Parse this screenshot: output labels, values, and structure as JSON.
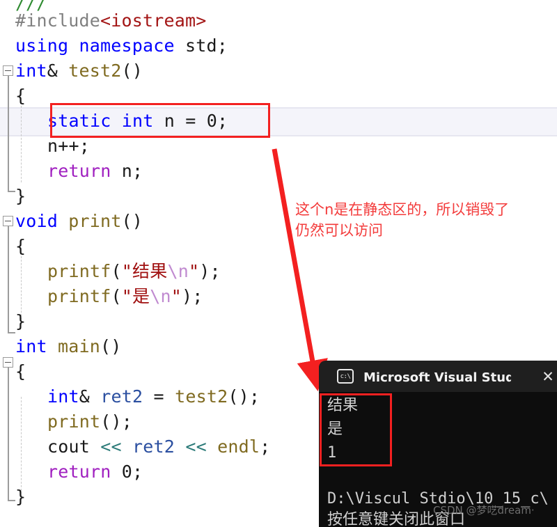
{
  "editor": {
    "top_cut_comment": "///",
    "lines": [
      {
        "indent": 0,
        "segments": [
          {
            "t": "#include",
            "c": "k-gray"
          },
          {
            "t": "<iostream>",
            "c": "k-darkred"
          }
        ]
      },
      {
        "indent": 0,
        "segments": [
          {
            "t": "using namespace ",
            "c": "k-blue"
          },
          {
            "t": "std;",
            "c": "k-black"
          }
        ]
      },
      {
        "indent": 0,
        "segments": [
          {
            "t": "int",
            "c": "k-blue"
          },
          {
            "t": "& ",
            "c": "k-black"
          },
          {
            "t": "test2",
            "c": "k-olive"
          },
          {
            "t": "()",
            "c": "k-black"
          }
        ]
      },
      {
        "indent": 0,
        "segments": [
          {
            "t": "{",
            "c": "k-black"
          }
        ]
      },
      {
        "indent": 1,
        "segments": [
          {
            "t": "static int",
            "c": "k-blue"
          },
          {
            "t": " n = ",
            "c": "k-black"
          },
          {
            "t": "0",
            "c": "k-black"
          },
          {
            "t": ";",
            "c": "k-black"
          }
        ]
      },
      {
        "indent": 1,
        "segments": [
          {
            "t": "n++;",
            "c": "k-black"
          }
        ]
      },
      {
        "indent": 1,
        "segments": [
          {
            "t": "return",
            "c": "k-purple"
          },
          {
            "t": " n;",
            "c": "k-black"
          }
        ]
      },
      {
        "indent": 0,
        "segments": [
          {
            "t": "}",
            "c": "k-black"
          }
        ]
      },
      {
        "indent": 0,
        "segments": [
          {
            "t": "void",
            "c": "k-blue"
          },
          {
            "t": " ",
            "c": "k-black"
          },
          {
            "t": "print",
            "c": "k-olive"
          },
          {
            "t": "()",
            "c": "k-black"
          }
        ]
      },
      {
        "indent": 0,
        "segments": [
          {
            "t": "{",
            "c": "k-black"
          }
        ]
      },
      {
        "indent": 1,
        "segments": [
          {
            "t": "printf",
            "c": "k-olive"
          },
          {
            "t": "(",
            "c": "k-black"
          },
          {
            "t": "\"结果",
            "c": "k-red"
          },
          {
            "t": "\\n",
            "c": "k-plum"
          },
          {
            "t": "\"",
            "c": "k-red"
          },
          {
            "t": ");",
            "c": "k-black"
          }
        ]
      },
      {
        "indent": 1,
        "segments": [
          {
            "t": "printf",
            "c": "k-olive"
          },
          {
            "t": "(",
            "c": "k-black"
          },
          {
            "t": "\"是",
            "c": "k-red"
          },
          {
            "t": "\\n",
            "c": "k-plum"
          },
          {
            "t": "\"",
            "c": "k-red"
          },
          {
            "t": ");",
            "c": "k-black"
          }
        ]
      },
      {
        "indent": 0,
        "segments": [
          {
            "t": "}",
            "c": "k-black"
          }
        ]
      },
      {
        "indent": 0,
        "segments": [
          {
            "t": "int",
            "c": "k-blue"
          },
          {
            "t": " ",
            "c": "k-black"
          },
          {
            "t": "main",
            "c": "k-olive"
          },
          {
            "t": "()",
            "c": "k-black"
          }
        ]
      },
      {
        "indent": 0,
        "segments": [
          {
            "t": "{",
            "c": "k-black"
          }
        ]
      },
      {
        "indent": 1,
        "segments": [
          {
            "t": "int",
            "c": "k-blue"
          },
          {
            "t": "& ",
            "c": "k-black"
          },
          {
            "t": "ret2",
            "c": "k-navy"
          },
          {
            "t": " = ",
            "c": "k-black"
          },
          {
            "t": "test2",
            "c": "k-olive"
          },
          {
            "t": "();",
            "c": "k-black"
          }
        ]
      },
      {
        "indent": 1,
        "segments": [
          {
            "t": "print",
            "c": "k-olive"
          },
          {
            "t": "();",
            "c": "k-black"
          }
        ]
      },
      {
        "indent": 1,
        "segments": [
          {
            "t": "cout ",
            "c": "k-black"
          },
          {
            "t": "<<",
            "c": "k-teal"
          },
          {
            "t": " ",
            "c": "k-black"
          },
          {
            "t": "ret2",
            "c": "k-navy"
          },
          {
            "t": " ",
            "c": "k-black"
          },
          {
            "t": "<<",
            "c": "k-teal"
          },
          {
            "t": " ",
            "c": "k-black"
          },
          {
            "t": "endl",
            "c": "k-olive"
          },
          {
            "t": ";",
            "c": "k-black"
          }
        ]
      },
      {
        "indent": 1,
        "segments": [
          {
            "t": "return",
            "c": "k-purple"
          },
          {
            "t": " ",
            "c": "k-black"
          },
          {
            "t": "0",
            "c": "k-black"
          },
          {
            "t": ";",
            "c": "k-black"
          }
        ]
      },
      {
        "indent": 0,
        "segments": [
          {
            "t": "}",
            "c": "k-black"
          }
        ]
      }
    ]
  },
  "annotation": {
    "line1": "这个n是在静态区的，所以销毁了",
    "line2": "仍然可以访问",
    "color": "#f33b3b"
  },
  "highlight": {
    "color": "#f32020",
    "code_box_label": "static int n = 0;",
    "console_box_label": "结果 是 1"
  },
  "console": {
    "icon": "console-icon",
    "title": "Microsoft Visual Studio 调试控",
    "close_label": "✕",
    "output": [
      "结果",
      "是",
      "1"
    ],
    "path_line": "D:\\Viscul Stdio\\10_15_c\\",
    "prompt_line": "按任意键关闭此窗口",
    "watermark": "CSDN @梦呓dream·"
  }
}
